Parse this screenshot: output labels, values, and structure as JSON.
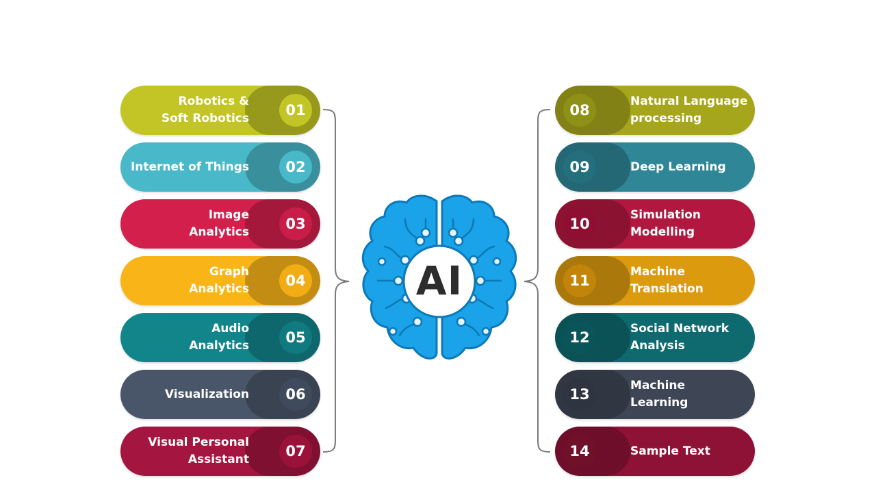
{
  "center": {
    "label": "AI",
    "brain_color": "#1aa3e8",
    "brain_outline": "#0c78b8"
  },
  "left_items": [
    {
      "num": "01",
      "lines": [
        "Robotics &",
        "Soft Robotics"
      ],
      "color": "#c2c525",
      "num_bg": "#c2c525"
    },
    {
      "num": "02",
      "lines": [
        "Internet of Things"
      ],
      "color": "#49b8c8",
      "num_bg": "#49b8c8"
    },
    {
      "num": "03",
      "lines": [
        "Image",
        "Analytics"
      ],
      "color": "#d21f4c",
      "num_bg": "#c71d47"
    },
    {
      "num": "04",
      "lines": [
        "Graph",
        "Analytics"
      ],
      "color": "#f9b518",
      "num_bg": "#f2ad14"
    },
    {
      "num": "05",
      "lines": [
        "Audio",
        "Analytics"
      ],
      "color": "#12858b",
      "num_bg": "#0f7a80"
    },
    {
      "num": "06",
      "lines": [
        "Visualization"
      ],
      "color": "#495669",
      "num_bg": "#3f4b5c"
    },
    {
      "num": "07",
      "lines": [
        "Visual Personal",
        "Assistant"
      ],
      "color": "#a4153f",
      "num_bg": "#9a123a"
    }
  ],
  "right_items": [
    {
      "num": "08",
      "lines": [
        "Natural Language",
        "processing"
      ],
      "color": "#a6a61c",
      "num_bg": "#8f9016"
    },
    {
      "num": "09",
      "lines": [
        "Deep Learning"
      ],
      "color": "#2f8696",
      "num_bg": "#246f7d"
    },
    {
      "num": "10",
      "lines": [
        "Simulation",
        "Modelling"
      ],
      "color": "#b2183f",
      "num_bg": "#8e0f31"
    },
    {
      "num": "11",
      "lines": [
        "Machine",
        "Translation"
      ],
      "color": "#dc9b0f",
      "num_bg": "#c2850a"
    },
    {
      "num": "12",
      "lines": [
        "Social Network",
        "Analysis"
      ],
      "color": "#0f6a6f",
      "num_bg": "#0a5559"
    },
    {
      "num": "13",
      "lines": [
        "Machine",
        "Learning"
      ],
      "color": "#3e4655",
      "num_bg": "#2e3541"
    },
    {
      "num": "14",
      "lines": [
        "Sample Text"
      ],
      "color": "#8e1236",
      "num_bg": "#701029"
    }
  ]
}
